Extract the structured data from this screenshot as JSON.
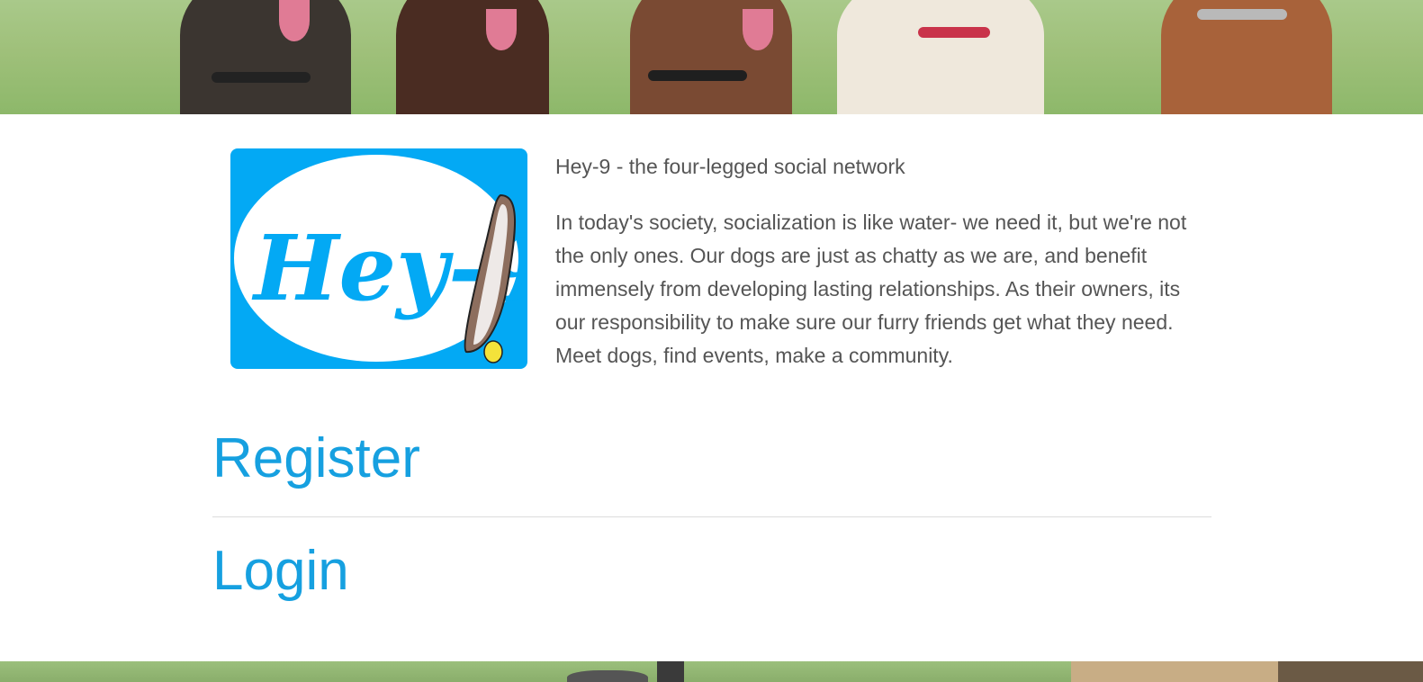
{
  "header": {
    "tagline": "Hey-9 - the four-legged social network"
  },
  "logo": {
    "text": "Hey-9"
  },
  "intro": {
    "text": "In today's society, socialization is like water- we need it, but we're not the only ones. Our dogs are just as chatty as we are, and benefit immensely from developing lasting relationships. As their owners, its our responsibility to make sure our furry friends get what they need. Meet dogs, find events, make a community."
  },
  "nav": {
    "register_label": "Register",
    "login_label": "Login"
  },
  "colors": {
    "accent": "#16a0e0",
    "logo_background": "#03a9f4",
    "text": "#555555"
  }
}
